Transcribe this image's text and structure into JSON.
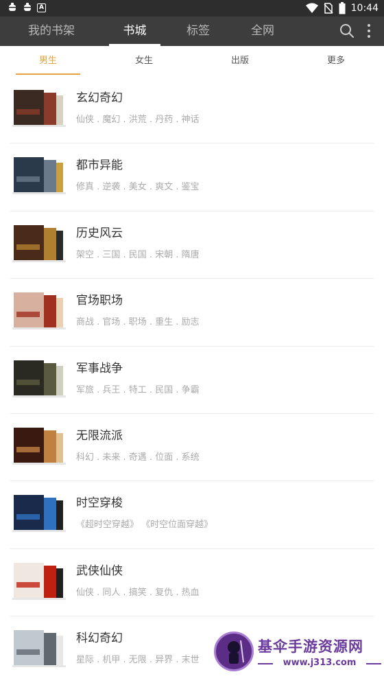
{
  "status_bar": {
    "left_icons": [
      "bug-icon",
      "bug-icon",
      "a-icon"
    ],
    "time": "10:44",
    "right_icons": [
      "wifi-icon",
      "no-sim-icon",
      "battery-icon"
    ]
  },
  "nav": {
    "tabs": [
      {
        "label": "我的书架",
        "active": false
      },
      {
        "label": "书城",
        "active": true
      },
      {
        "label": "标签",
        "active": false
      },
      {
        "label": "全网",
        "active": false
      }
    ],
    "actions": [
      "search-icon",
      "more-vert-icon"
    ]
  },
  "sub_tabs": {
    "items": [
      {
        "label": "男生",
        "active": true
      },
      {
        "label": "女生",
        "active": false
      },
      {
        "label": "出版",
        "active": false
      },
      {
        "label": "更多",
        "active": false
      }
    ]
  },
  "categories": [
    {
      "title": "玄幻奇幻",
      "tags": "仙侠 . 魔幻 . 洪荒 . 丹药 . 神话"
    },
    {
      "title": "都市异能",
      "tags": "修真 . 逆袭 . 美女 . 爽文 . 鉴宝"
    },
    {
      "title": "历史风云",
      "tags": "架空 . 三国 . 民国 . 宋朝 . 隋唐"
    },
    {
      "title": "官场职场",
      "tags": "商战 . 官场 . 职场 . 重生 . 励志"
    },
    {
      "title": "军事战争",
      "tags": "军旅 . 兵王 . 特工 . 民国 . 争霸"
    },
    {
      "title": "无限流派",
      "tags": "科幻 . 未来 . 奇遇 . 位面 . 系统"
    },
    {
      "title": "时空穿梭",
      "tags": "《超时空穿越》 《时空位面穿越》"
    },
    {
      "title": "武侠仙侠",
      "tags": "仙侠 . 同人 . 搞笑 . 复仇 . 热血"
    },
    {
      "title": "科幻奇幻",
      "tags": "星际 . 机甲 . 无限 . 异界 . 末世"
    }
  ],
  "cover_palettes": [
    [
      "#3a2a22",
      "#8a3b2a",
      "#d8d0c0"
    ],
    [
      "#2a3a4a",
      "#6a7a8a",
      "#c8a040"
    ],
    [
      "#4a2a18",
      "#b08030",
      "#2a2a2a"
    ],
    [
      "#d8b0a0",
      "#a03020",
      "#e8d0b0"
    ],
    [
      "#2a2a22",
      "#5a5a40",
      "#d0d0c0"
    ],
    [
      "#3a1a10",
      "#c08040",
      "#e0c090"
    ],
    [
      "#1a2a4a",
      "#3070c0",
      "#202020"
    ],
    [
      "#f0e8e0",
      "#c02010",
      "#202020"
    ],
    [
      "#c0c8d0",
      "#606870",
      "#e8e8e8"
    ]
  ],
  "watermark": {
    "title": "基伞手游资源网",
    "url": "www.j313.com"
  },
  "colors": {
    "status_bar_bg": "#2d2d2d",
    "app_bar_bg": "#3d3d3d",
    "accent": "#e8a23e",
    "watermark_purple": "#6a3b9c"
  }
}
